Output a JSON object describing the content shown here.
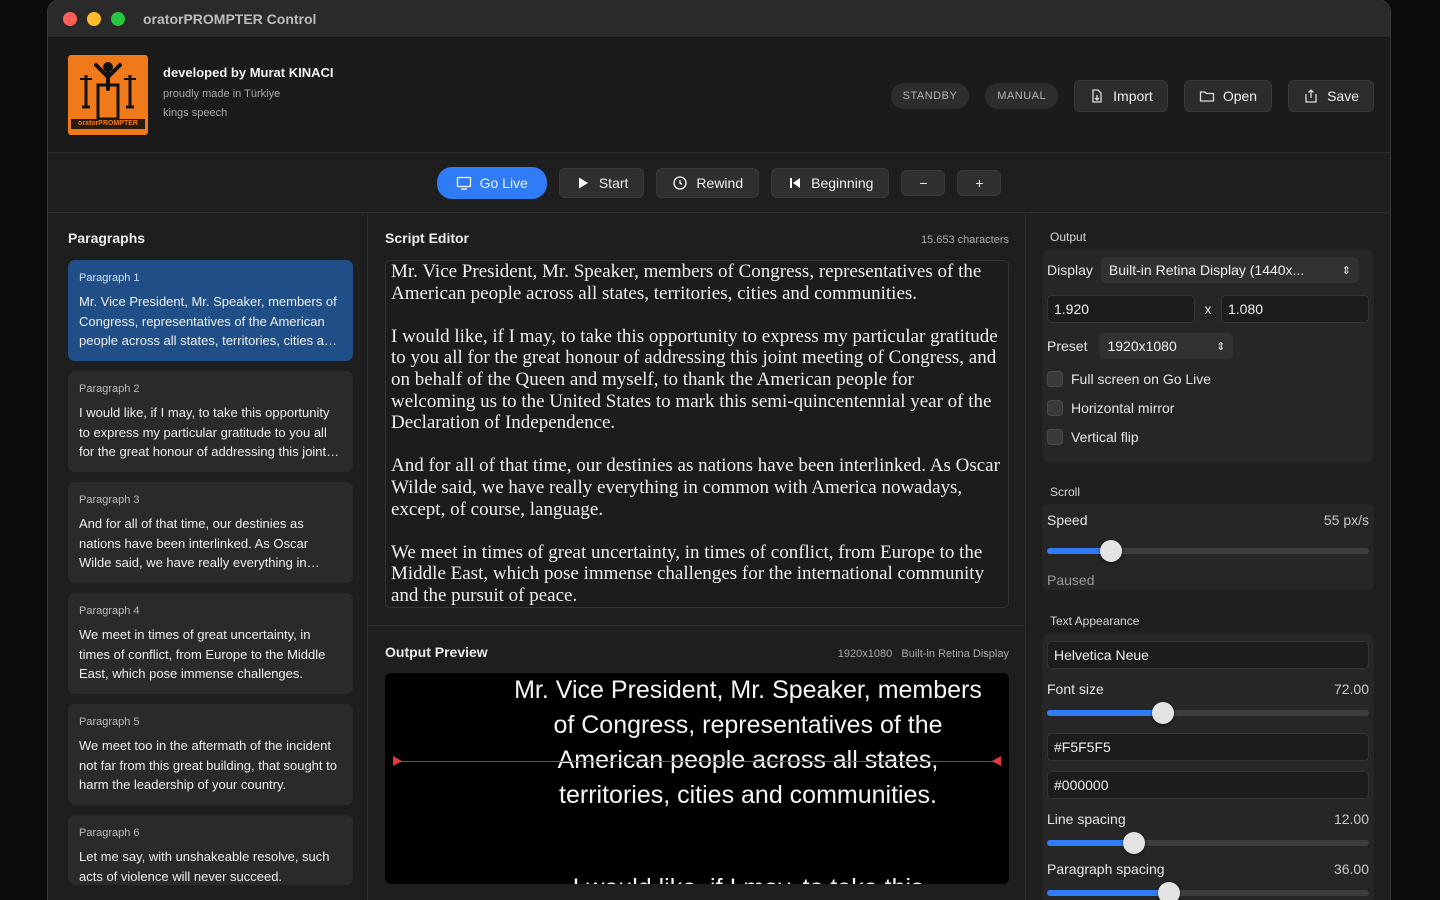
{
  "window": {
    "title": "oratorPROMPTER Control"
  },
  "header": {
    "logo_text": "oratorPROMPTER",
    "developer": "developed by Murat KINACI",
    "made_in": "proudly made in Türkiye",
    "doc_name": "kings speech",
    "status_standby": "STANDBY",
    "status_manual": "MANUAL",
    "import_label": "Import",
    "open_label": "Open",
    "save_label": "Save"
  },
  "toolbar": {
    "go_live": "Go Live",
    "start": "Start",
    "rewind": "Rewind",
    "beginning": "Beginning",
    "minus": "−",
    "plus": "+"
  },
  "paragraphs": {
    "title": "Paragraphs",
    "items": [
      {
        "heading": "Paragraph 1",
        "text": "Mr. Vice President, Mr. Speaker, members of Congress, representatives of the American people across all states, territories, cities and communities."
      },
      {
        "heading": "Paragraph 2",
        "text": "I would like, if I may, to take this opportunity to express my particular gratitude to you all for the great honour of addressing this joint meeting."
      },
      {
        "heading": "Paragraph 3",
        "text": "And for all of that time, our destinies as nations have been interlinked. As Oscar Wilde said, we have really everything in common with America."
      },
      {
        "heading": "Paragraph 4",
        "text": "We meet in times of great uncertainty, in times of conflict, from Europe to the Middle East, which pose immense challenges."
      },
      {
        "heading": "Paragraph 5",
        "text": "We meet too in the aftermath of the incident not far from this great building, that sought to harm the leadership of your country."
      },
      {
        "heading": "Paragraph 6",
        "text": "Let me say, with unshakeable resolve, such acts of violence will never succeed."
      }
    ]
  },
  "editor": {
    "title": "Script Editor",
    "char_count": "15.653 characters",
    "paragraphs": [
      "Mr. Vice President, Mr. Speaker, members of Congress, representatives of the American people across all states, territories, cities and communities.",
      "I would like, if I may, to take this opportunity to express my particular gratitude to you all for the great honour of addressing this joint meeting of Congress, and on behalf of the Queen and myself, to thank the American people for welcoming us to the United States to mark this semi-quincentennial year of the Declaration of Independence.",
      "And for all of that time, our destinies as nations have been interlinked. As Oscar Wilde said, we have really everything in common with America nowadays, except, of course, language.",
      "We meet in times of great uncertainty, in times of conflict, from Europe to the Middle East, which pose immense challenges for the international community and the pursuit of peace."
    ]
  },
  "preview": {
    "title": "Output Preview",
    "resolution": "1920x1080",
    "display": "Built-in Retina Display",
    "text": "Mr. Vice President, Mr. Speaker, members of Congress, representatives of the American people across all states, territories, cities and communities.",
    "next_text": "I would like, if I may, to take this"
  },
  "output": {
    "title": "Output",
    "display_label": "Display",
    "display_value": "Built-in Retina Display (1440x...",
    "width": "1.920",
    "times": "x",
    "height": "1.080",
    "preset_label": "Preset",
    "preset_value": "1920x1080",
    "fullscreen": "Full screen on Go Live",
    "mirror": "Horizontal mirror",
    "flip": "Vertical flip"
  },
  "scroll": {
    "title": "Scroll",
    "speed_label": "Speed",
    "speed_value": "55 px/s",
    "speed_fraction": 0.2,
    "state": "Paused"
  },
  "appearance": {
    "title": "Text Appearance",
    "font": "Helvetica Neue",
    "font_size_label": "Font size",
    "font_size_value": "72.00",
    "font_size_fraction": 0.36,
    "text_color": "#F5F5F5",
    "bg_color": "#000000",
    "line_spacing_label": "Line spacing",
    "line_spacing_value": "12.00",
    "line_spacing_fraction": 0.27,
    "para_spacing_label": "Paragraph spacing",
    "para_spacing_value": "36.00",
    "para_spacing_fraction": 0.38
  },
  "colors": {
    "accent": "#2f7cf6",
    "selected": "#1f4f86",
    "logo": "#f07a1a"
  }
}
